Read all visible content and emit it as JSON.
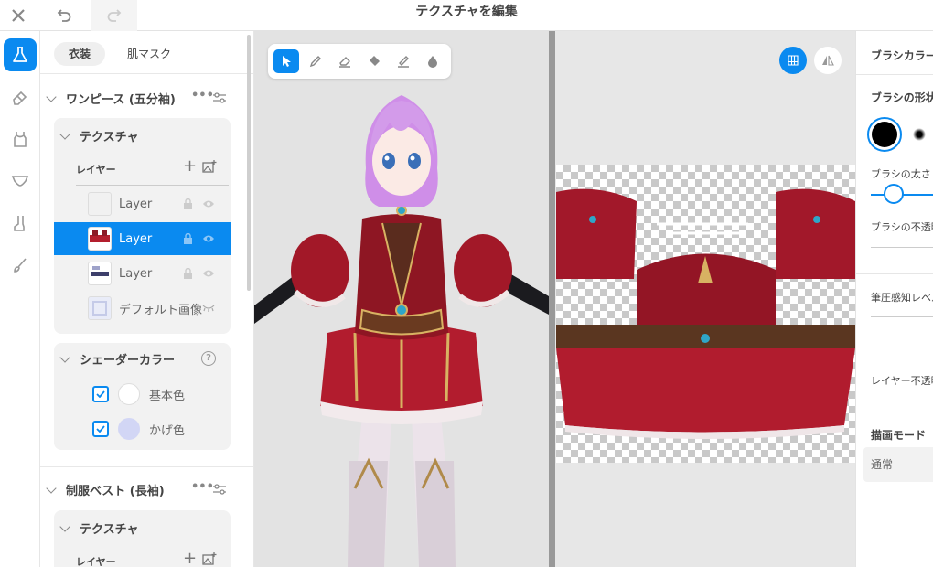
{
  "header": {
    "title": "テクスチャを編集"
  },
  "tabs": [
    "衣装",
    "肌マスク"
  ],
  "sections": [
    {
      "title": "ワンピース (五分袖)",
      "texture_label": "テクスチャ",
      "layer_label": "レイヤー",
      "layers": [
        {
          "name": "Layer",
          "selected": false
        },
        {
          "name": "Layer",
          "selected": true
        },
        {
          "name": "Layer",
          "selected": false
        },
        {
          "name": "デフォルト画像",
          "selected": false
        }
      ],
      "shader_label": "シェーダーカラー",
      "shader_colors": [
        {
          "name": "基本色",
          "checked": true,
          "color": "#ffffff"
        },
        {
          "name": "かげ色",
          "checked": true,
          "color": "#d2d6f5"
        }
      ]
    },
    {
      "title": "制服ベスト (長袖)",
      "texture_label": "テクスチャ",
      "layer_label": "レイヤー"
    }
  ],
  "right_panel": {
    "header": "ブラシカラー",
    "brush_shape": "ブラシの形状",
    "brush_size": "ブラシの太さ",
    "brush_opacity": "ブラシの不透明度",
    "pressure": "筆圧感知レベル",
    "layer_opacity": "レイヤー不透明度",
    "draw_mode_label": "描画モード",
    "draw_mode_value": "通常"
  },
  "colors": {
    "accent": "#0a8af0"
  }
}
